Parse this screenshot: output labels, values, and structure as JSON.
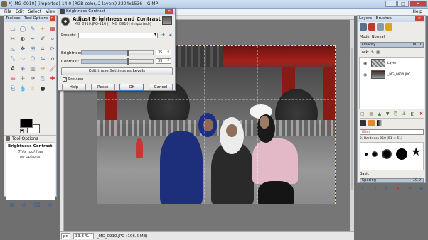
{
  "window": {
    "title": "*[_MG_0910] (imported)-14.0 (RGB color, 2 layers) 2304x1536 – GIMP",
    "minimize": "–",
    "maximize": "□",
    "close": "✕"
  },
  "menu": [
    "File",
    "Edit",
    "Select",
    "View",
    "Im",
    "",
    "",
    "",
    "Help"
  ],
  "toolbox": {
    "title": "Toolbox - Tool Options",
    "close": "✕",
    "tools": [
      {
        "icon": "rect-select-icon",
        "glyph": "▭",
        "color": "#5b7fb5"
      },
      {
        "icon": "ellipse-select-icon",
        "glyph": "◯",
        "color": "#5b7fb5"
      },
      {
        "icon": "free-select-icon",
        "glyph": "✎",
        "color": "#5b7fb5"
      },
      {
        "icon": "fuzzy-select-icon",
        "glyph": "✦",
        "color": "#d8a020"
      },
      {
        "icon": "color-select-icon",
        "glyph": "▦",
        "color": "#c0392b"
      },
      {
        "icon": "scissors-icon",
        "glyph": "✂",
        "color": "#444"
      },
      {
        "icon": "foreground-select-icon",
        "glyph": "◐",
        "color": "#555"
      },
      {
        "icon": "paths-icon",
        "glyph": "✒",
        "color": "#5b7fb5"
      },
      {
        "icon": "color-picker-icon",
        "glyph": "✐",
        "color": "#333"
      },
      {
        "icon": "zoom-icon",
        "glyph": "⌕",
        "color": "#333"
      },
      {
        "icon": "measure-icon",
        "glyph": "◺",
        "color": "#5b7fb5"
      },
      {
        "icon": "move-icon",
        "glyph": "✥",
        "color": "#2a4f8a"
      },
      {
        "icon": "align-icon",
        "glyph": "⊞",
        "color": "#5b7fb5"
      },
      {
        "icon": "crop-icon",
        "glyph": "⌗",
        "color": "#333"
      },
      {
        "icon": "rotate-icon",
        "glyph": "⟳",
        "color": "#5b7fb5"
      },
      {
        "icon": "scale-icon",
        "glyph": "⤡",
        "color": "#5b7fb5"
      },
      {
        "icon": "shear-icon",
        "glyph": "▱",
        "color": "#5b7fb5"
      },
      {
        "icon": "perspective-icon",
        "glyph": "⬠",
        "color": "#5b7fb5"
      },
      {
        "icon": "flip-icon",
        "glyph": "⇋",
        "color": "#5b7fb5"
      },
      {
        "icon": "cage-icon",
        "glyph": "⌂",
        "color": "#555"
      },
      {
        "icon": "text-icon",
        "glyph": "A",
        "color": "#111"
      },
      {
        "icon": "bucket-fill-icon",
        "glyph": "◈",
        "color": "#5b7fb5"
      },
      {
        "icon": "blend-icon",
        "glyph": "▥",
        "color": "#7a7a7a"
      },
      {
        "icon": "pencil-icon",
        "glyph": "✏",
        "color": "#c98a1a"
      },
      {
        "icon": "paintbrush-icon",
        "glyph": "🖌",
        "color": "#c98a1a"
      },
      {
        "icon": "eraser-icon",
        "glyph": "▬",
        "color": "#e48aa0"
      },
      {
        "icon": "airbrush-icon",
        "glyph": "✈",
        "color": "#555"
      },
      {
        "icon": "ink-icon",
        "glyph": "✑",
        "color": "#333"
      },
      {
        "icon": "clone-icon",
        "glyph": "⎘",
        "color": "#5b7fb5"
      },
      {
        "icon": "heal-icon",
        "glyph": "✚",
        "color": "#c0392b"
      },
      {
        "icon": "perspective-clone-icon",
        "glyph": "⎗",
        "color": "#5b7fb5"
      },
      {
        "icon": "blur-icon",
        "glyph": "💧",
        "color": "#4a8ad0"
      },
      {
        "icon": "smudge-icon",
        "glyph": "☝",
        "color": "#c98a1a"
      },
      {
        "icon": "dodge-burn-icon",
        "glyph": "●",
        "color": "#333"
      }
    ],
    "tab_label": "Tool Options",
    "panel_heading": "Brightness-Contrast",
    "panel_note_1": "This tool has",
    "panel_note_2": "no options."
  },
  "dialog": {
    "title": "Brightness-Contrast",
    "close": "✕",
    "heading": "Adjust Brightness and Contrast",
    "subheading": "_MG_0910.JPG-116 ([_MG_0910] (imported))",
    "presets_label": "Presets:",
    "presets_value": "",
    "brightness_label": "Brightness:",
    "brightness_value": "35",
    "brightness_level": 0.64,
    "contrast_label": "Contrast:",
    "contrast_value": "39",
    "contrast_level": 0.65,
    "levels_button": "Edit these Settings as Levels",
    "preview_label": "Preview",
    "preview_checked": "✓",
    "help": "Help",
    "reset": "Reset",
    "ok": "OK",
    "cancel": "Cancel"
  },
  "layers": {
    "title": "Layers - Brushes",
    "close": "✕",
    "mode_label": "Mode:",
    "mode_value": "Normal",
    "opacity_label": "Opacity",
    "opacity_value": "100.0",
    "lock_label": "Lock:",
    "items": [
      {
        "name": "Layer"
      },
      {
        "name": "_MG_0910.JPG"
      }
    ],
    "filter_placeholder": "filter",
    "brush_name": "2. Hardness 050 (51 × 51)",
    "brush_set": "Basic",
    "spacing_label": "Spacing",
    "spacing_value": "10.0"
  },
  "status": {
    "units": "px",
    "zoom": "33.3 %",
    "info": "_MG_0910.JPG (106.6 MB)"
  }
}
